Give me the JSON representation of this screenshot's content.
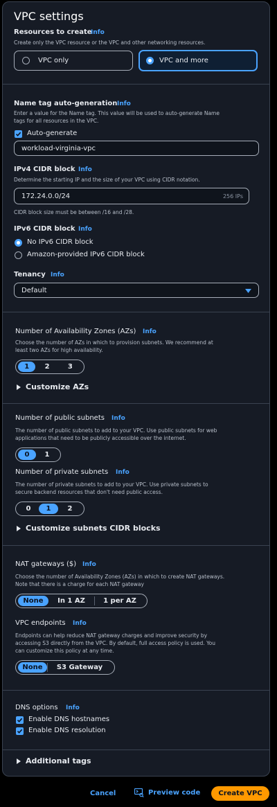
{
  "title": "VPC settings",
  "info": "Info",
  "resources": {
    "label": "Resources to create",
    "desc": "Create only the VPC resource or the VPC and other networking resources.",
    "options": [
      "VPC only",
      "VPC and more"
    ],
    "selected": "VPC and more"
  },
  "name_tag": {
    "label": "Name tag auto-generation",
    "desc1": "Enter a value for the Name tag. This value will be used to auto-generate Name",
    "desc2": "tags for all resources in the VPC.",
    "auto_label": "Auto-generate",
    "value": "workload-virginia-vpc"
  },
  "ipv4": {
    "label": "IPv4 CIDR block",
    "desc": "Determine the starting IP and the size of your VPC using CIDR notation.",
    "value": "172.24.0.0/24",
    "suffix": "256 IPs",
    "hint": "CIDR block size must be between /16 and /28."
  },
  "ipv6": {
    "label": "IPv6 CIDR block",
    "options": [
      "No IPv6 CIDR block",
      "Amazon-provided IPv6 CIDR block"
    ],
    "selected": "No IPv6 CIDR block"
  },
  "tenancy": {
    "label": "Tenancy",
    "value": "Default"
  },
  "azs": {
    "label": "Number of Availability Zones (AZs)",
    "desc1": "Choose the number of AZs in which to provision subnets. We recommend at",
    "desc2": "least two AZs for high availability.",
    "options": [
      "1",
      "2",
      "3"
    ],
    "selected": "1",
    "customize": "Customize AZs"
  },
  "public_subnets": {
    "label": "Number of public subnets",
    "desc1": "The number of public subnets to add to your VPC. Use public subnets for web",
    "desc2": "applications that need to be publicly accessible over the internet.",
    "options": [
      "0",
      "1"
    ],
    "selected": "0"
  },
  "private_subnets": {
    "label": "Number of private subnets",
    "desc1": "The number of private subnets to add to your VPC. Use private subnets to",
    "desc2": "secure backend resources that don't need public access.",
    "options": [
      "0",
      "1",
      "2"
    ],
    "selected": "1",
    "customize": "Customize subnets CIDR blocks"
  },
  "nat": {
    "label": "NAT gateways ($)",
    "desc1": "Choose the number of Availability Zones (AZs) in which to create NAT gateways.",
    "desc2": "Note that there is a charge for each NAT gateway",
    "options": [
      "None",
      "In 1 AZ",
      "1 per AZ"
    ],
    "selected": "None"
  },
  "endpoints": {
    "label": "VPC endpoints",
    "desc1": "Endpoints can help reduce NAT gateway charges and improve security by",
    "desc2": "accessing S3 directly from the VPC. By default, full access policy is used. You",
    "desc3": "can customize this policy at any time.",
    "options": [
      "None",
      "S3 Gateway"
    ],
    "selected": "None"
  },
  "dns": {
    "label": "DNS options",
    "hostnames": "Enable DNS hostnames",
    "resolution": "Enable DNS resolution"
  },
  "additional_tags": "Additional tags",
  "footer": {
    "cancel": "Cancel",
    "preview": "Preview code",
    "create": "Create VPC"
  },
  "colors": {
    "accent": "#4aa3ff",
    "primary": "#ff9900",
    "panel": "#161b25"
  }
}
